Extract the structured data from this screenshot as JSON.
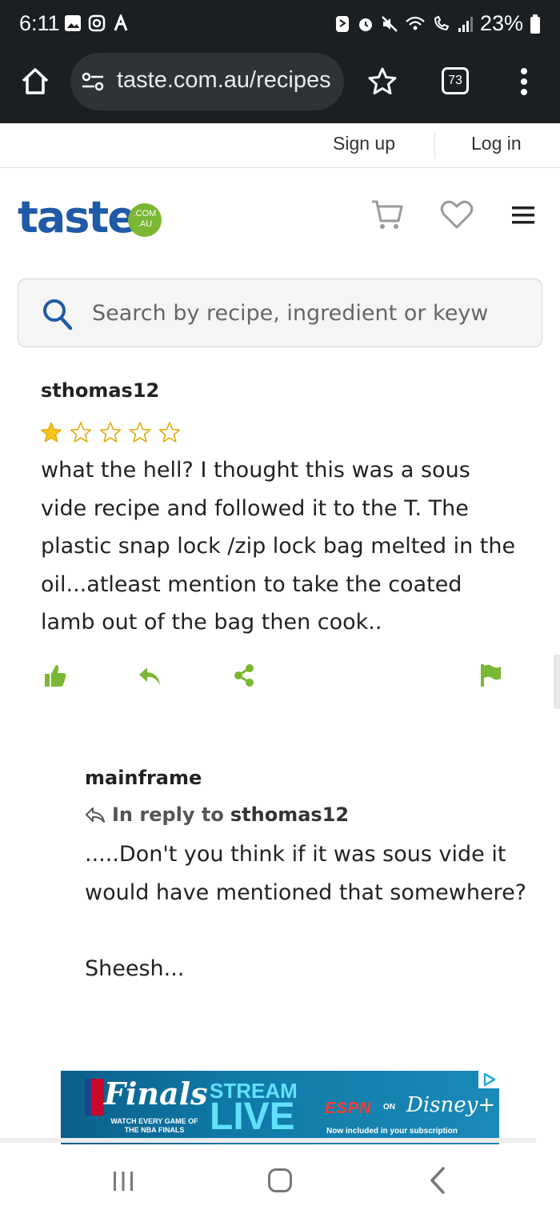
{
  "status_bar": {
    "time": "6:11",
    "battery": "23%",
    "icons_left": [
      "gallery-icon",
      "instagram-icon",
      "a-icon"
    ],
    "icons_right": [
      "nfc-icon",
      "alarm-icon",
      "mute-icon",
      "wifi-icon",
      "wifi-call-icon",
      "signal-icon",
      "battery-icon"
    ]
  },
  "browser": {
    "url": "taste.com.au/recipes",
    "tab_count": "73"
  },
  "top_links": {
    "signup": "Sign up",
    "login": "Log in"
  },
  "header": {
    "logo_text": "taste",
    "logo_badge": ".COM .AU"
  },
  "search": {
    "placeholder": "Search by recipe, ingredient or keyword"
  },
  "comment": {
    "author": "sthomas12",
    "rating": 1,
    "rating_max": 5,
    "text": "what the hell? I thought this was a sous vide recipe and followed it to the T. The plastic snap lock /zip lock bag melted in the oil...atleast mention to take the coated lamb out of the bag then cook.."
  },
  "reply": {
    "author": "mainframe",
    "in_reply_label": "In reply to",
    "in_reply_target": "sthomas12",
    "text": ".....Don't you think if it was sous vide it would have mentioned that somewhere?\n\nSheesh..."
  },
  "ad": {
    "finals": "Finals",
    "watch": "WATCH EVERY GAME OF THE NBA FINALS",
    "stream": "STREAM",
    "live": "LIVE",
    "espn": "ESPN",
    "on": "ON",
    "disney": "Disney+",
    "sub": "Now included in your subscription"
  },
  "colors": {
    "brand_blue": "#1e5aa6",
    "brand_green": "#7ab733",
    "star_gold": "#f5c518",
    "action_green": "#7ab733"
  }
}
